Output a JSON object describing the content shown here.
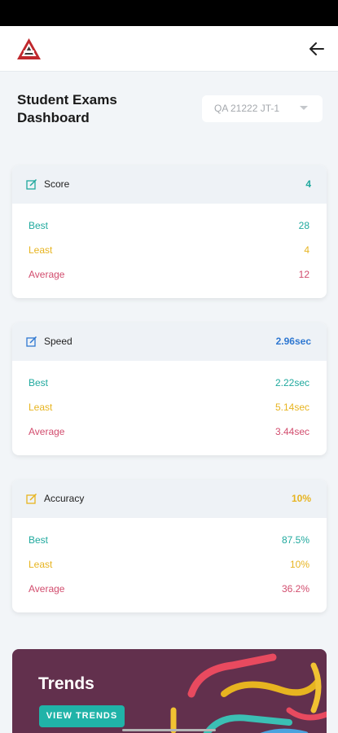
{
  "header": {
    "logo_icon": "triangle-logo-icon",
    "back_icon": "arrow-left-icon"
  },
  "page": {
    "title_line1": "Student Exams",
    "title_line2": "Dashboard"
  },
  "exam_select": {
    "selected": "QA 21222 JT-1",
    "icon": "caret-down-icon"
  },
  "cards": {
    "score": {
      "title": "Score",
      "value": "4",
      "best_label": "Best",
      "best_value": "28",
      "least_label": "Least",
      "least_value": "4",
      "average_label": "Average",
      "average_value": "12",
      "icon": "edit-icon",
      "accent": "#20a99e"
    },
    "speed": {
      "title": "Speed",
      "value": "2.96sec",
      "best_label": "Best",
      "best_value": "2.22sec",
      "least_label": "Least",
      "least_value": "5.14sec",
      "average_label": "Average",
      "average_value": "3.44sec",
      "icon": "edit-icon",
      "accent": "#2f78d1"
    },
    "accuracy": {
      "title": "Accuracy",
      "value": "10%",
      "best_label": "Best",
      "best_value": "87.5%",
      "least_label": "Least",
      "least_value": "10%",
      "average_label": "Average",
      "average_value": "36.2%",
      "icon": "edit-icon",
      "accent": "#e7b420"
    }
  },
  "trends": {
    "title": "Trends",
    "button_label": "VIEW TRENDS",
    "background": "#62304d",
    "button_color": "#20b3a8"
  },
  "colors": {
    "best": "#20a99e",
    "least": "#e7b420",
    "average": "#d24d6e"
  }
}
